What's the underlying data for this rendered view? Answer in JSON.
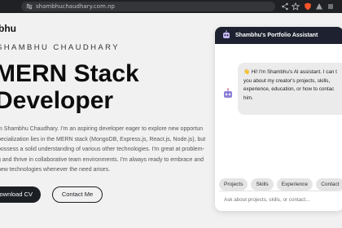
{
  "browser": {
    "url": "shambhuchaudhary.com.np"
  },
  "site": {
    "logo": "bhu",
    "kicker": "SHAMBHU CHAUDHARY",
    "headline_line1": "MERN Stack",
    "headline_line2": "Developer",
    "bio_lines": [
      "m Shambhu Chaudhary. I'm an aspiring developer eager to explore new opportun",
      "pecialization lies in the MERN stack (MongoDB, Express.js, React.js, Node.js), but",
      "possess a solid understanding of various other technologies. I'm great at problem-",
      "g and thrive in collaborative team environments. I'm always ready to embrace and",
      "new technologies whenever the need arises."
    ],
    "download_button": "Download CV",
    "contact_button": "Contact Me"
  },
  "chat": {
    "title": "Shambhu's Portfolio Assistant",
    "message_lines": [
      "👋 Hi! I'm Shambhu's AI assistant. I can t",
      "you about my creator's projects, skills,",
      "experience, education, or how to contac",
      "him."
    ],
    "chips": [
      "Projects",
      "Skills",
      "Experience",
      "Contact"
    ],
    "input_placeholder": "Ask about projects, skills, or contact..."
  },
  "colors": {
    "accent_dark": "#1c1f24",
    "chat_header": "#1e2230",
    "browser_chrome": "#202124"
  }
}
